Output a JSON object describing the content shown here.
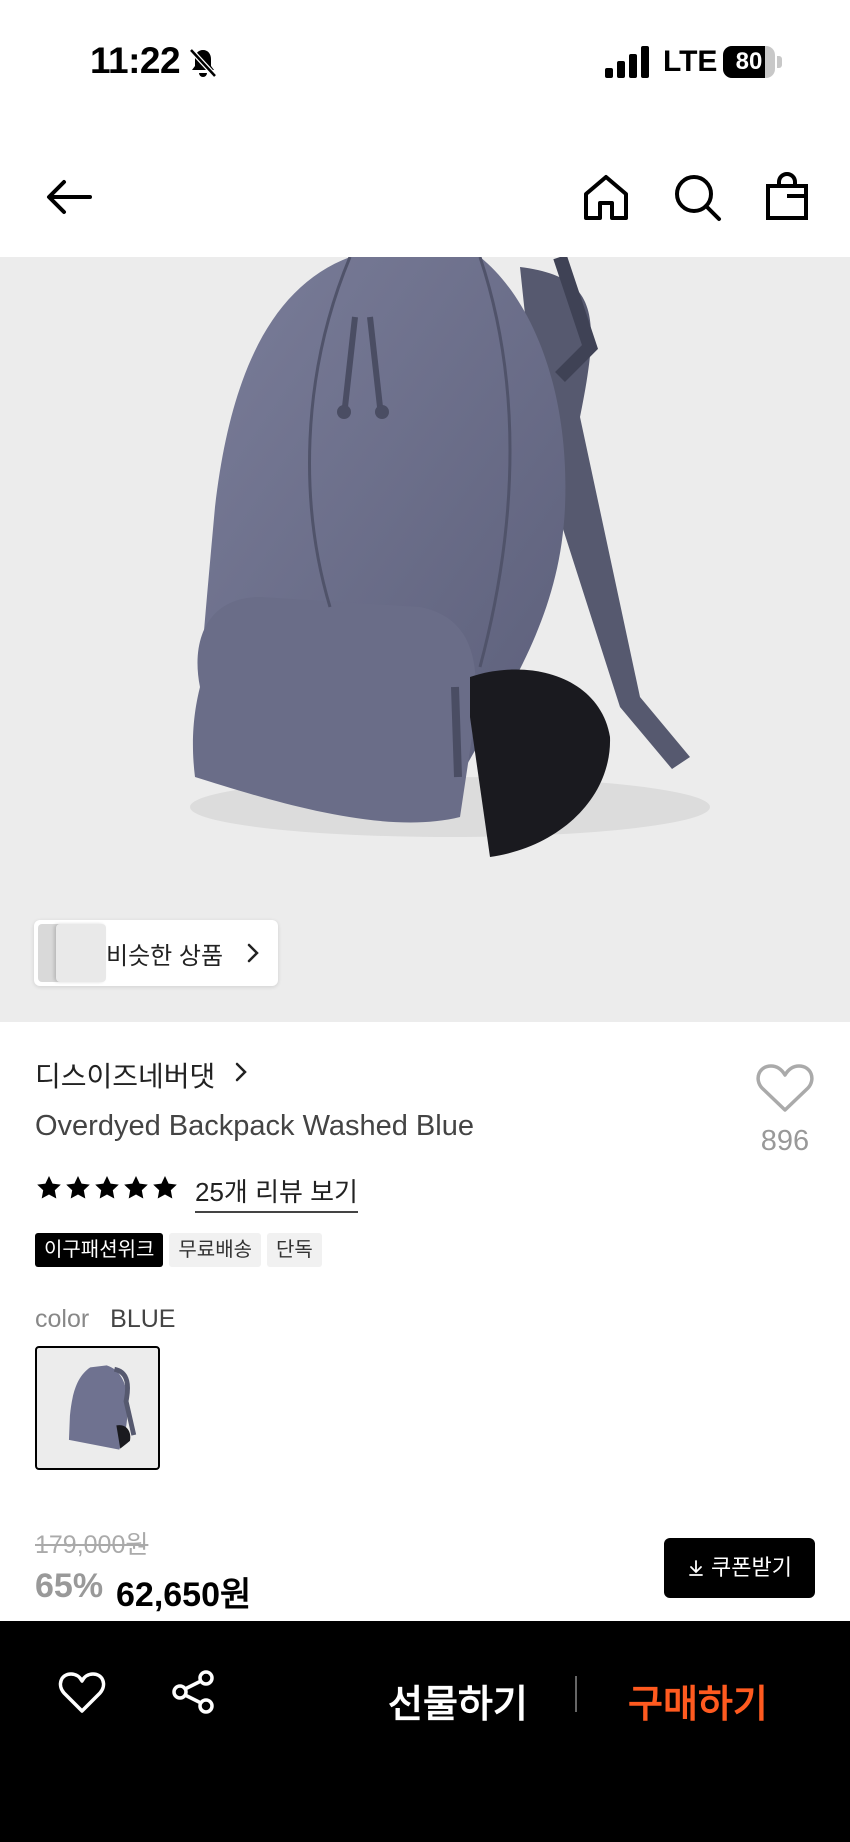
{
  "status_bar": {
    "time": "11:22",
    "network": "LTE",
    "battery": "80",
    "battery_level": 0.8
  },
  "nav": {
    "icons": [
      "back-arrow-icon",
      "home-icon",
      "search-icon",
      "shopping-bag-icon"
    ]
  },
  "hero": {
    "similar_label": "비슷한 상품",
    "bag_color": "#6f7290"
  },
  "product": {
    "brand": "디스이즈네버댓",
    "title": "Overdyed Backpack Washed Blue",
    "likes": "896",
    "rating_stars": 5,
    "review_link": "25개 리뷰 보기",
    "tags": [
      "이구패션위크",
      "무료배송",
      "단독"
    ],
    "color_label": "color",
    "color_value": "BLUE"
  },
  "price": {
    "original": "179,000원",
    "discount": "65%",
    "sale": "62,650원",
    "coupon_label": "쿠폰받기"
  },
  "bottom_bar": {
    "gift_label": "선물하기",
    "buy_label": "구매하기",
    "buy_color": "#ff5a1f"
  }
}
